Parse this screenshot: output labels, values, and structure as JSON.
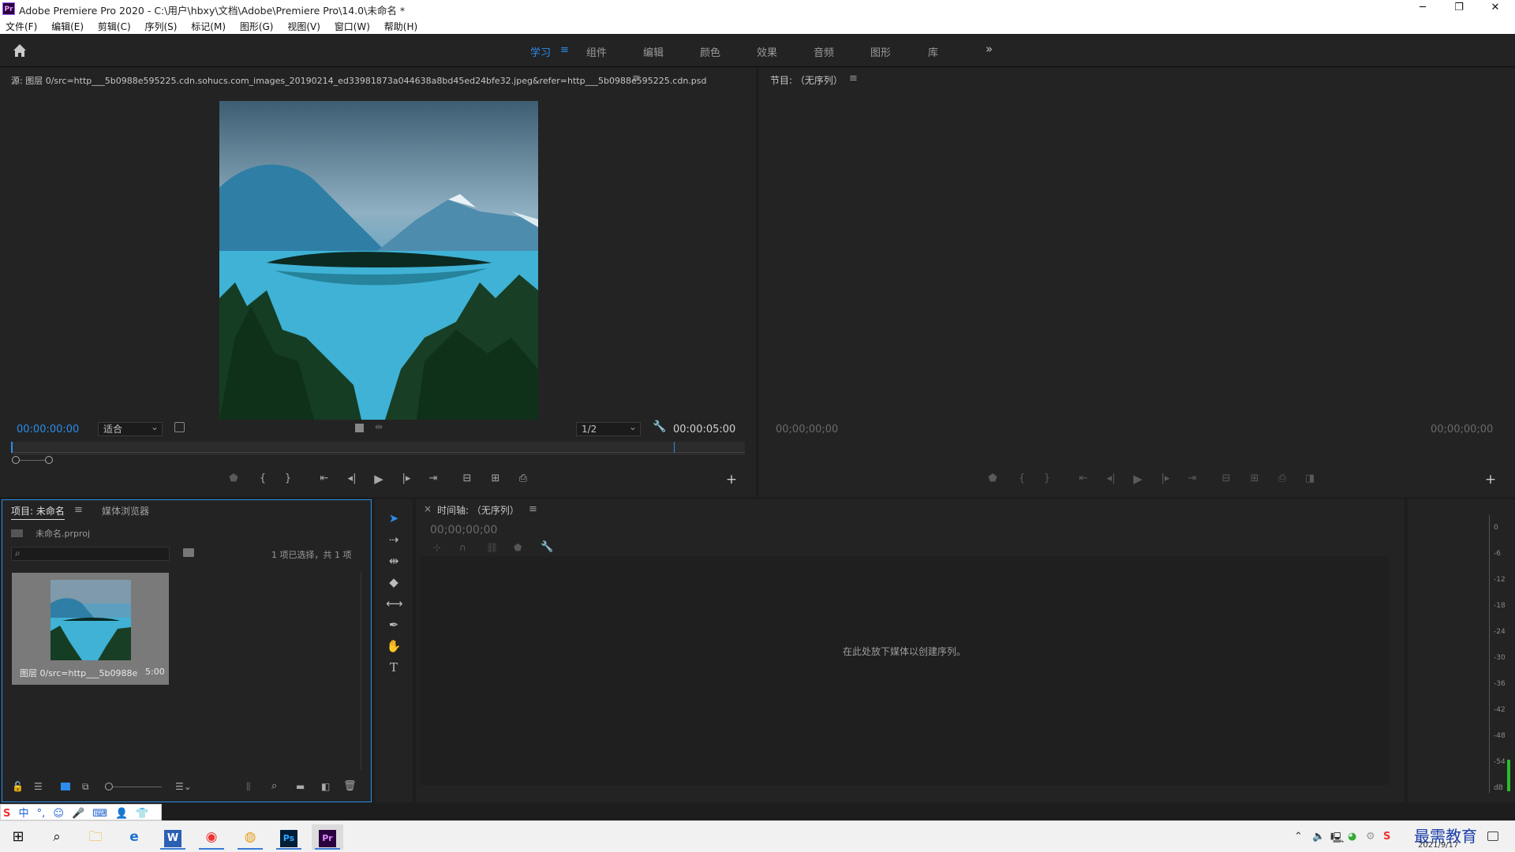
{
  "window": {
    "title": "Adobe Premiere Pro 2020 - C:\\用户\\hbxy\\文档\\Adobe\\Premiere Pro\\14.0\\未命名 *",
    "app_icon": "Pr",
    "minimize": "─",
    "restore": "❐",
    "close": "✕"
  },
  "menu": [
    "文件(F)",
    "编辑(E)",
    "剪辑(C)",
    "序列(S)",
    "标记(M)",
    "图形(G)",
    "视图(V)",
    "窗口(W)",
    "帮助(H)"
  ],
  "workspaces": {
    "tabs": [
      "学习",
      "组件",
      "编辑",
      "颜色",
      "效果",
      "音频",
      "图形",
      "库"
    ],
    "active": "学习",
    "more": "»",
    "menu": "≡"
  },
  "source": {
    "title": "源: 图层 0/src=http___5b0988e595225.cdn.sohucs.com_images_20190214_ed33981873a044638a8bd45ed24bfe32.jpeg&refer=http___5b0988e595225.cdn.psd",
    "menu": "≡",
    "timecode_in": "00:00:00:00",
    "zoom": "适合",
    "resolution": "1/2",
    "duration": "00:00:05:00"
  },
  "program": {
    "title": "节目: （无序列）",
    "menu": "≡",
    "timecode_in": "00;00;00;00",
    "timecode_out": "00;00;00;00"
  },
  "project": {
    "tab_project": "项目: 未命名",
    "tab_menu": "≡",
    "tab_media": "媒体浏览器",
    "file": "未命名.prproj",
    "selection": "1 项已选择，共 1 项",
    "item_name": "图层 0/src=http___5b0988e...",
    "item_duration": "5:00"
  },
  "timeline": {
    "close": "×",
    "title": "时间轴: （无序列）",
    "menu": "≡",
    "timecode": "00;00;00;00",
    "empty_msg": "在此处放下媒体以创建序列。"
  },
  "meter": {
    "labels": [
      "0",
      "-6",
      "-12",
      "-18",
      "-24",
      "-30",
      "-36",
      "-42",
      "-48",
      "-54",
      "dB"
    ]
  },
  "taskbar": {
    "date": "2021/9/17",
    "watermark": "最需教育",
    "ime": [
      "中",
      "°,",
      "☺",
      "🎤",
      "⌨",
      "👤",
      "👕",
      "⊞"
    ]
  }
}
